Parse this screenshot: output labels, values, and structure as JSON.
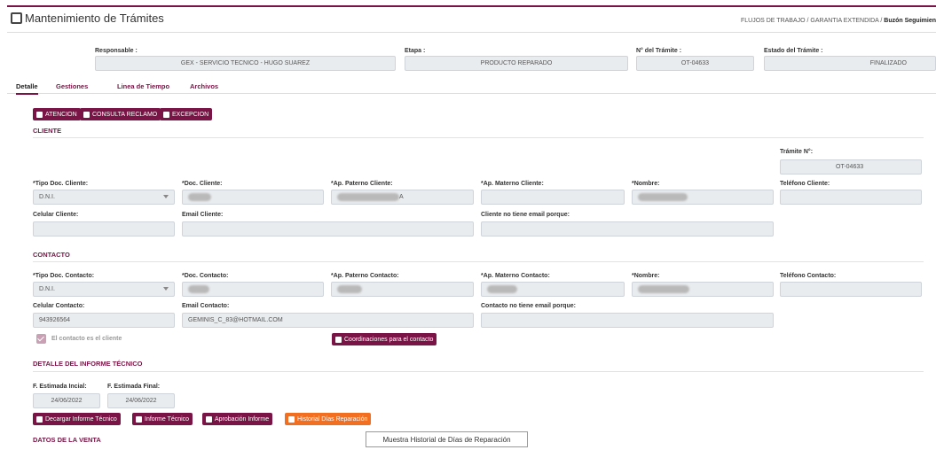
{
  "header": {
    "title": "Mantenimiento de Trámites",
    "breadcrumb_path": "FLUJOS DE TRABAJO / GARANTIA EXTENDIDA / ",
    "breadcrumb_current": "Buzón Seguimien"
  },
  "summary": {
    "responsable_label": "Responsable :",
    "responsable_value": "GEX - SERVICIO TECNICO - HUGO SUAREZ",
    "etapa_label": "Etapa :",
    "etapa_value": "PRODUCTO REPARADO",
    "tramite_label": "N° del Trámite :",
    "tramite_value": "OT-04633",
    "estado_label": "Estado del Trámite :",
    "estado_value": "FINALIZADO"
  },
  "tabs": [
    "Detalle",
    "Gestiones",
    "Linea de Tiempo",
    "Archivos"
  ],
  "action_buttons": [
    "ATENCION",
    "CONSULTA RECLAMO",
    "EXCEPCION"
  ],
  "cliente": {
    "section_title": "CLIENTE",
    "tramite_label": "Trámite N°:",
    "tramite_value": "OT-04633",
    "tipo_doc_label": "*Tipo Doc. Cliente:",
    "tipo_doc_value": "D.N.I.",
    "doc_label": "*Doc. Cliente:",
    "ap_paterno_label": "*Ap. Paterno Cliente:",
    "ap_paterno_suffix": "A",
    "ap_materno_label": "*Ap. Materno Cliente:",
    "nombre_label": "*Nombre:",
    "telefono_label": "Teléfono Cliente:",
    "celular_label": "Celular Cliente:",
    "email_label": "Email Cliente:",
    "no_email_label": "Cliente no tiene email porque:"
  },
  "contacto": {
    "section_title": "CONTACTO",
    "tipo_doc_label": "*Tipo Doc. Contacto:",
    "tipo_doc_value": "D.N.I.",
    "doc_label": "*Doc. Contacto:",
    "ap_paterno_label": "*Ap. Paterno Contacto:",
    "ap_materno_label": "*Ap. Materno Contacto:",
    "nombre_label": "*Nombre:",
    "telefono_label": "Teléfono Contacto:",
    "celular_label": "Celular Contacto:",
    "celular_value": "943926564",
    "email_label": "Email Contacto:",
    "email_value": "GEMINIS_C_83@HOTMAIL.COM",
    "no_email_label": "Contacto no tiene email porque:",
    "es_cliente_label": "El contacto es el cliente",
    "coordinaciones_button": "Coordinaciones para el contacto"
  },
  "informe": {
    "section_title": "DETALLE DEL INFORME TÉCNICO",
    "f_inicial_label": "F. Estimada Incial:",
    "f_inicial_value": "24/06/2022",
    "f_final_label": "F. Estimada Final:",
    "f_final_value": "24/06/2022",
    "buttons": [
      "Decargar Informe Técnico",
      "Informe Técnico",
      "Aprobación Informe",
      "Historial Días Reparación"
    ],
    "tooltip": "Muestra Historial de Días de Reparación"
  },
  "venta": {
    "section_title": "DATOS DE LA VENTA"
  },
  "colors": {
    "primary": "#7a1446",
    "orange": "#f26f21",
    "field_bg": "#e9ecef"
  }
}
